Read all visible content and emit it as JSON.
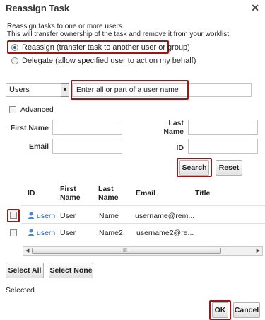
{
  "dialog": {
    "title": "Reassign Task",
    "close_glyph": "✕"
  },
  "description": {
    "line1": "Reassign tasks to one or more users.",
    "line2": "This will transfer ownership of the task and remove it from your worklist."
  },
  "options": {
    "reassign_label": "Reassign (transfer task to another user or group)",
    "delegate_label": "Delegate (allow specified user to act on my behalf)",
    "selected": "reassign"
  },
  "search": {
    "type_value": "Users",
    "type_arrow": "▼",
    "input_value": "Enter all or part of a user name",
    "advanced_label": "Advanced",
    "first_name_label": "First Name",
    "last_name_label_1": "Last",
    "last_name_label_2": "Name",
    "email_label": "Email",
    "id_label": "ID",
    "search_button": "Search",
    "reset_button": "Reset"
  },
  "table": {
    "headers": {
      "id": "ID",
      "first_name_1": "First",
      "first_name_2": "Name",
      "last_name_1": "Last",
      "last_name_2": "Name",
      "email": "Email",
      "title": "Title"
    },
    "rows": [
      {
        "id": "usern",
        "first_name": "User",
        "last_name": "Name",
        "email": "username@rem..."
      },
      {
        "id": "usern",
        "first_name": "User",
        "last_name": "Name2",
        "email": "username2@re..."
      }
    ],
    "scroll_left": "◀",
    "scroll_right": "▶",
    "scroll_grip": "III"
  },
  "actions": {
    "select_all": "Select All",
    "select_none": "Select None",
    "selected_label": "Selected",
    "ok": "OK",
    "cancel": "Cancel"
  },
  "colors": {
    "highlight": "#a01414",
    "link": "#1d5aa8",
    "radio_selected": "#2a5db0"
  },
  "icons": {
    "user_row_icon": "user-icon",
    "close": "close-icon"
  }
}
